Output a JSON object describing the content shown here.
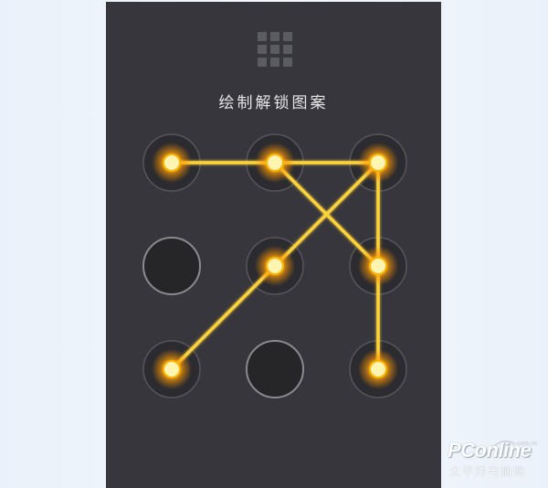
{
  "screen": {
    "title": "绘制解锁图案",
    "menu_icon": "grid-menu-icon"
  },
  "pattern": {
    "grid_size": 3,
    "dots": [
      {
        "row": 1,
        "col": 1,
        "active": true
      },
      {
        "row": 1,
        "col": 2,
        "active": true
      },
      {
        "row": 1,
        "col": 3,
        "active": true
      },
      {
        "row": 2,
        "col": 1,
        "active": false
      },
      {
        "row": 2,
        "col": 2,
        "active": true
      },
      {
        "row": 2,
        "col": 3,
        "active": true
      },
      {
        "row": 3,
        "col": 1,
        "active": true
      },
      {
        "row": 3,
        "col": 2,
        "active": false
      },
      {
        "row": 3,
        "col": 3,
        "active": true
      }
    ],
    "path": [
      "1-1",
      "1-2",
      "1-3",
      "2-2",
      "3-1"
    ],
    "path2": [
      "1-2",
      "2-3"
    ],
    "path3": [
      "1-3",
      "2-3",
      "3-3"
    ],
    "colors": {
      "active_core": "#fff4b0",
      "active_glow": "#ffb300",
      "line": "#ffd23a",
      "inactive_fill": "#262629",
      "inactive_ring": "#8a8a90"
    }
  },
  "watermark": {
    "brand": "PConline",
    "domain": "com.cn",
    "sub": "太平洋电脑网"
  }
}
